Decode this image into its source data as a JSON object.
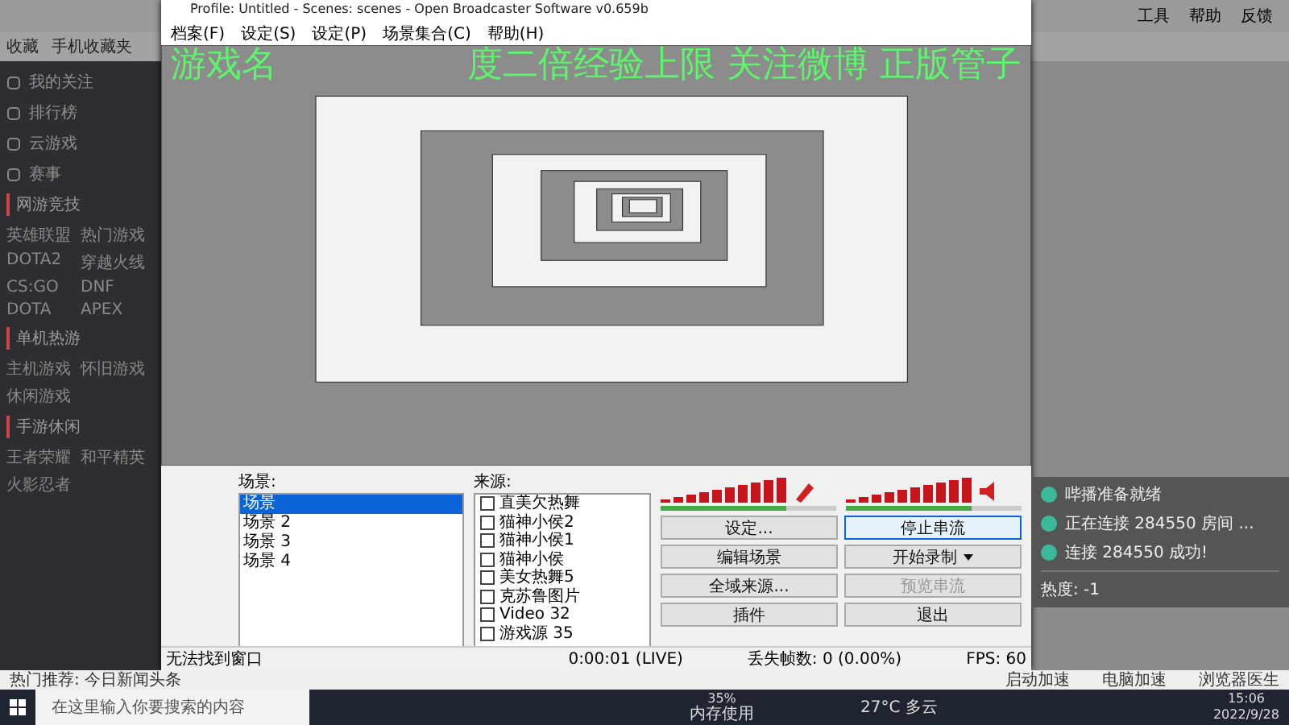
{
  "browser": {
    "bookmarks": [
      "收藏",
      "手机收藏夹"
    ],
    "menu": [
      "工具",
      "帮助",
      "反馈"
    ]
  },
  "sidebar": {
    "items": [
      "我的关注",
      "排行榜",
      "云游戏",
      "赛事"
    ],
    "sections": [
      {
        "title": "网游竞技",
        "tags": [
          "英雄联盟",
          "热门游戏",
          "DOTA2",
          "穿越火线",
          "CS:GO",
          "DNF",
          "DOTA",
          "APEX"
        ]
      },
      {
        "title": "单机热游",
        "tags": [
          "主机游戏",
          "怀旧游戏",
          "休闲游戏"
        ]
      },
      {
        "title": "手游休闲",
        "tags": [
          "王者荣耀",
          "和平精英",
          "火影忍者"
        ]
      }
    ]
  },
  "obs": {
    "title": "Profile: Untitled - Scenes: scenes - Open Broadcaster Software v0.659b",
    "menu": [
      "档案(F)",
      "设定(S)",
      "设定(P)",
      "场景集合(C)",
      "帮助(H)"
    ],
    "overlay": {
      "left": "游戏名",
      "right": "度二倍经验上限  关注微博  正版管子"
    },
    "scenes_label": "场景:",
    "scenes": [
      {
        "name": "场景",
        "selected": true
      },
      {
        "name": "场景 2",
        "selected": false
      },
      {
        "name": "场景 3",
        "selected": false
      },
      {
        "name": "场景 4",
        "selected": false
      }
    ],
    "sources_label": "来源:",
    "sources": [
      {
        "name": "直美欠热舞",
        "checked": false
      },
      {
        "name": "猫神小侯2",
        "checked": false
      },
      {
        "name": "猫神小侯1",
        "checked": false
      },
      {
        "name": "猫神小侯",
        "checked": false
      },
      {
        "name": "美女热舞5",
        "checked": false
      },
      {
        "name": "克苏鲁图片",
        "checked": false
      },
      {
        "name": "Video 32",
        "checked": false
      },
      {
        "name": "游戏源 35",
        "checked": false
      }
    ],
    "meters": [
      {
        "kind": "mic",
        "level": 0.72
      },
      {
        "kind": "speaker",
        "level": 0.72
      }
    ],
    "buttons": [
      {
        "label": "设定...",
        "focused": false,
        "disabled": false,
        "dropdown": false
      },
      {
        "label": "停止串流",
        "focused": true,
        "disabled": false,
        "dropdown": false
      },
      {
        "label": "编辑场景",
        "focused": false,
        "disabled": false,
        "dropdown": false
      },
      {
        "label": "开始录制",
        "focused": false,
        "disabled": false,
        "dropdown": true
      },
      {
        "label": "全域来源...",
        "focused": false,
        "disabled": false,
        "dropdown": false
      },
      {
        "label": "预览串流",
        "focused": false,
        "disabled": true,
        "dropdown": false
      },
      {
        "label": "插件",
        "focused": false,
        "disabled": false,
        "dropdown": false
      },
      {
        "label": "退出",
        "focused": false,
        "disabled": false,
        "dropdown": false
      }
    ],
    "status": [
      "无法找到窗口",
      "0:00:01 (LIVE)",
      "丢失帧数: 0 (0.00%)",
      "FPS: 60"
    ]
  },
  "chat": {
    "messages": [
      "哔播准备就绪",
      "正在连接 284550 房间 ...",
      "连接 284550 成功!"
    ],
    "heat": "热度: -1"
  },
  "newsbar": {
    "headline": "热门推荐: 今日新闻头条",
    "items": [
      "启动加速",
      "电脑加速",
      "浏览器医生"
    ]
  },
  "taskbar": {
    "search": "在这里输入你要搜索的内容",
    "memory": "35%",
    "memory_label": "内存使用",
    "weather": "27°C 多云",
    "time": "15:06",
    "date": "2022/9/28"
  }
}
